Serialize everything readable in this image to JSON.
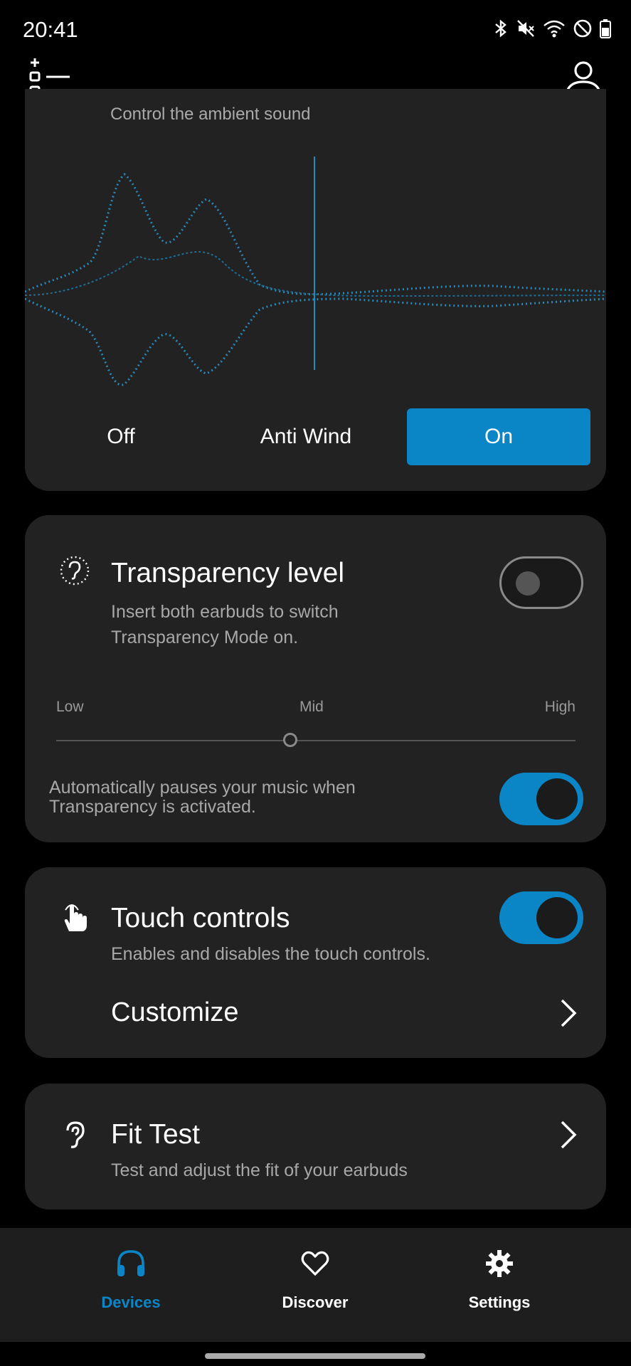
{
  "status_bar": {
    "time": "20:41",
    "icons": [
      "bluetooth-icon",
      "mute-icon",
      "wifi-icon",
      "do-not-disturb-icon",
      "battery-icon"
    ]
  },
  "app_bar": {
    "left_icon": "device-list-add-icon",
    "right_icon": "profile-icon"
  },
  "anc_card": {
    "subtitle": "Control the ambient sound",
    "modes": [
      {
        "label": "Off",
        "selected": false
      },
      {
        "label": "Anti Wind",
        "selected": false
      },
      {
        "label": "On",
        "selected": true
      }
    ],
    "accent": "#0a86c6"
  },
  "transparency_card": {
    "icon": "ear-dotted-icon",
    "title": "Transparency level",
    "description": "Insert both earbuds to switch Transparency Mode on.",
    "toggle_on": false,
    "slider": {
      "low_label": "Low",
      "mid_label": "Mid",
      "high_label": "High",
      "value_fraction": 0.45
    },
    "auto_pause_text": "Automatically pauses your music when Transparency is activated.",
    "auto_pause_on": true
  },
  "touch_card": {
    "icon": "touch-hand-icon",
    "title": "Touch controls",
    "description": "Enables and disables the touch controls.",
    "toggle_on": true,
    "customize_label": "Customize"
  },
  "fit_card": {
    "icon": "ear-icon",
    "title": "Fit Test",
    "description": "Test and adjust the fit of your earbuds"
  },
  "bottom_nav": {
    "items": [
      {
        "label": "Devices",
        "icon": "headphones-icon",
        "active": true
      },
      {
        "label": "Discover",
        "icon": "heart-icon",
        "active": false
      },
      {
        "label": "Settings",
        "icon": "gear-icon",
        "active": false
      }
    ]
  }
}
